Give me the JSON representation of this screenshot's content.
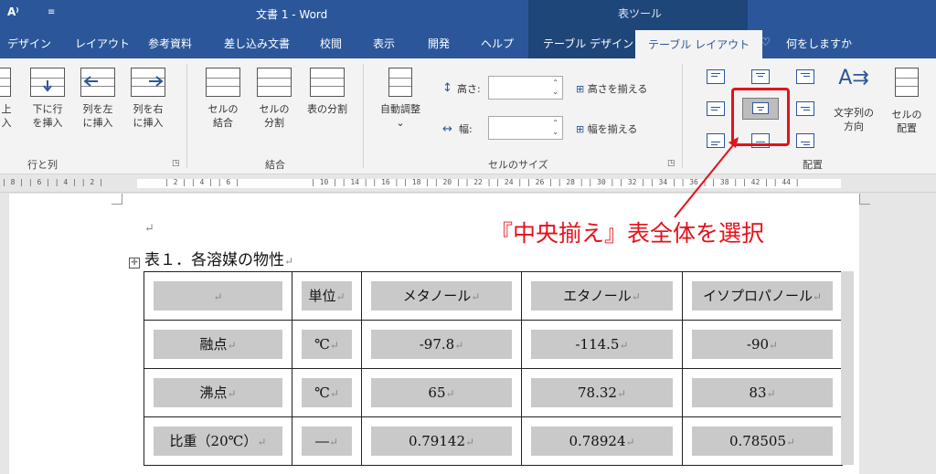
{
  "titlebar": {
    "read_aloud": "A⁾",
    "qa_more": "≡",
    "title": "文書 1  -  Word",
    "context_title": "表ツール"
  },
  "tabs": [
    "デザイン",
    "レイアウト",
    "参考資料",
    "差し込み文書",
    "校閲",
    "表示",
    "開発",
    "ヘルプ",
    "テーブル デザイン",
    "テーブル レイアウト"
  ],
  "tell_me": "何をしますか",
  "ribbon": {
    "rows_cols": {
      "insert_above_lines": [
        "上",
        "入"
      ],
      "insert_below_lines": [
        "下に行",
        "を挿入"
      ],
      "insert_left_lines": [
        "列を左",
        "に挿入"
      ],
      "insert_right_lines": [
        "列を右",
        "に挿入"
      ],
      "group": "行と列"
    },
    "merge": {
      "merge_cells_lines": [
        "セルの",
        "結合"
      ],
      "split_cells_lines": [
        "セルの",
        "分割"
      ],
      "split_table": "表の分割",
      "group": "結合"
    },
    "cell_size": {
      "autofit": "自動調整",
      "autofit_caret": "⌄",
      "height_label": "高さ:",
      "width_label": "幅:",
      "height_value": "",
      "width_value": "",
      "distribute_rows": "高さを揃える",
      "distribute_cols": "幅を揃える",
      "group": "セルのサイズ"
    },
    "alignment": {
      "text_direction_lines": [
        "文字列の",
        "方向"
      ],
      "cell_margins_lines": [
        "セルの",
        "配置"
      ],
      "group": "配置",
      "selected": "center-center"
    }
  },
  "ruler": {
    "left": "| 8 |  | 6 |  | 4 |  | 2 |",
    "mid": "|  2 |  | 4 |  | 6 |",
    "right": "| 10 |      | 14 |  | 16 |  | 18 |  | 20 |  | 22 |  | 24 |  | 26 |  | 28 |  | 30 |  | 32 |  | 34 |  | 36 |  | 38 |     | 42 |  | 44 |"
  },
  "document": {
    "empty_para_mark": "↵",
    "caption": "表１．各溶媒の物性",
    "caption_mark": "↵",
    "table": {
      "header": [
        "",
        "単位",
        "メタノール",
        "エタノール",
        "イソプロパノール"
      ],
      "rows": [
        [
          "融点",
          "℃",
          "-97.8",
          "-114.5",
          "-90"
        ],
        [
          "沸点",
          "℃",
          "65",
          "78.32",
          "83"
        ],
        [
          "比重（20℃）",
          "―",
          "0.79142",
          "0.78924",
          "0.78505"
        ]
      ],
      "cell_mark": "↵"
    }
  },
  "annotation": {
    "text": "『中央揃え』表全体を選択",
    "color": "#e3121b"
  },
  "colors": {
    "word_blue": "#2b579a",
    "context_blue": "#1f4679",
    "ribbon_bg": "#f3f3f3",
    "cell_shading": "#c9c9c9"
  }
}
